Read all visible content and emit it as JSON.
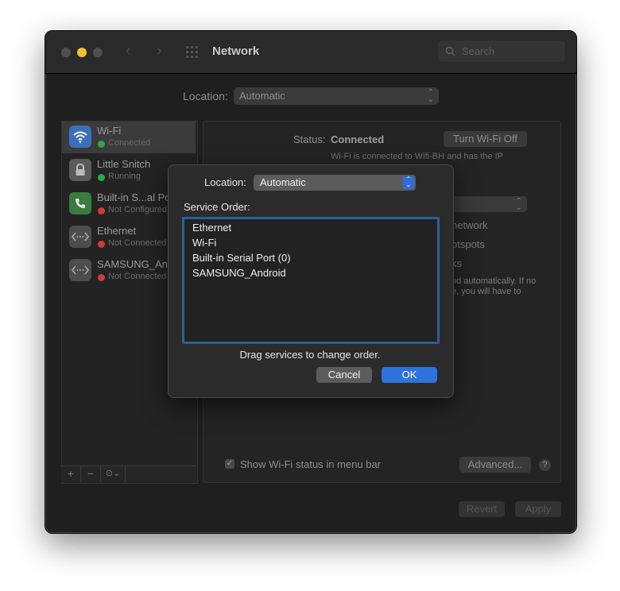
{
  "window": {
    "title": "Network",
    "search_placeholder": "Search",
    "location_label": "Location:",
    "location_value": "Automatic"
  },
  "sidebar": {
    "items": [
      {
        "name": "Wi-Fi",
        "status": "Connected",
        "status_color": "#2ca84a"
      },
      {
        "name": "Little Snitch",
        "status": "Running",
        "status_color": "#2ca84a"
      },
      {
        "name": "Built-in S...al Port",
        "status": "Not Configured",
        "status_color": "#d23a3a"
      },
      {
        "name": "Ethernet",
        "status": "Not Connected",
        "status_color": "#d23a3a"
      },
      {
        "name": "SAMSUNG_Android",
        "status": "Not Connected",
        "status_color": "#d23a3a"
      }
    ],
    "add_label": "+",
    "remove_label": "−",
    "action_label": "⊙⌄"
  },
  "detail": {
    "status_label": "Status:",
    "status_value": "Connected",
    "turn_off_label": "Turn Wi-Fi Off",
    "description": "Wi-Fi is connected to Wifi-BH and has the IP",
    "partial_1": "network",
    "partial_2": "otspots",
    "partial_3": "ks",
    "partial_4": "nd automatically. If no",
    "partial_5": "e, you will have to",
    "show_wifi_label": "Show Wi-Fi status in menu bar",
    "show_wifi_checked": true,
    "advanced_label": "Advanced...",
    "help_label": "?",
    "revert_label": "Revert",
    "apply_label": "Apply"
  },
  "sheet": {
    "location_label": "Location:",
    "location_value": "Automatic",
    "service_order_label": "Service Order:",
    "services": [
      "Ethernet",
      "Wi-Fi",
      "Built-in Serial Port (0)",
      "SAMSUNG_Android"
    ],
    "hint": "Drag services to change order.",
    "cancel_label": "Cancel",
    "ok_label": "OK"
  },
  "colors": {
    "accent": "#2e72db",
    "focus_ring": "#2b5f96",
    "traffic_light_minimize": "#f5bd2e"
  }
}
